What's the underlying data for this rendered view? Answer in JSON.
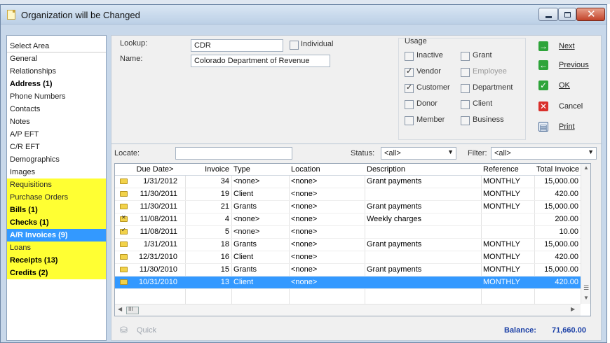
{
  "window": {
    "title": "Organization will be Changed"
  },
  "sidebar": {
    "header": "Select Area",
    "items": [
      {
        "label": "General",
        "style": "normal"
      },
      {
        "label": "Relationships",
        "style": "normal"
      },
      {
        "label": "Address (1)",
        "style": "bold"
      },
      {
        "label": "Phone Numbers",
        "style": "normal"
      },
      {
        "label": "Contacts",
        "style": "normal"
      },
      {
        "label": "Notes",
        "style": "normal"
      },
      {
        "label": "A/P EFT",
        "style": "normal"
      },
      {
        "label": "C/R EFT",
        "style": "normal"
      },
      {
        "label": "Demographics",
        "style": "normal"
      },
      {
        "label": "Images",
        "style": "normal"
      },
      {
        "label": "Requisitions",
        "style": "hl"
      },
      {
        "label": "Purchase Orders",
        "style": "hl"
      },
      {
        "label": "Bills (1)",
        "style": "hl-bold"
      },
      {
        "label": "Checks (1)",
        "style": "hl-bold"
      },
      {
        "label": "A/R Invoices (9)",
        "style": "selected"
      },
      {
        "label": "Loans",
        "style": "hl"
      },
      {
        "label": "Receipts (13)",
        "style": "hl-bold"
      },
      {
        "label": "Credits (2)",
        "style": "hl-bold"
      }
    ]
  },
  "form": {
    "lookup_label": "Lookup:",
    "lookup_value": "CDR",
    "individual_label": "Individual",
    "name_label": "Name:",
    "name_value": "Colorado Department of Revenue"
  },
  "usage": {
    "title": "Usage",
    "options": [
      {
        "label": "Inactive",
        "checked": false,
        "enabled": true
      },
      {
        "label": "Grant",
        "checked": false,
        "enabled": true
      },
      {
        "label": "Vendor",
        "checked": true,
        "enabled": true
      },
      {
        "label": "Employee",
        "checked": false,
        "enabled": false
      },
      {
        "label": "Customer",
        "checked": true,
        "enabled": true
      },
      {
        "label": "Department",
        "checked": false,
        "enabled": true
      },
      {
        "label": "Donor",
        "checked": false,
        "enabled": true
      },
      {
        "label": "Client",
        "checked": false,
        "enabled": true
      },
      {
        "label": "Member",
        "checked": false,
        "enabled": true
      },
      {
        "label": "Business",
        "checked": false,
        "enabled": true
      }
    ]
  },
  "actions": {
    "next": "Next",
    "previous": "Previous",
    "ok": "OK",
    "cancel": "Cancel",
    "print": "Print"
  },
  "filters": {
    "locate_label": "Locate:",
    "locate_value": "",
    "status_label": "Status:",
    "status_value": "<all>",
    "filter_label": "Filter:",
    "filter_value": "<all>"
  },
  "grid": {
    "columns": [
      "Due Date>",
      "Invoice",
      "Type",
      "Location",
      "Description",
      "Reference",
      "Total Invoice"
    ],
    "rows": [
      {
        "icon": "folder",
        "due": "1/31/2012",
        "invoice": "34",
        "type": "<none>",
        "location": "<none>",
        "description": "Grant payments",
        "reference": "MONTHLY",
        "total": "15,000.00"
      },
      {
        "icon": "folder",
        "due": "11/30/2011",
        "invoice": "19",
        "type": "Client",
        "location": "<none>",
        "description": "",
        "reference": "MONTHLY",
        "total": "420.00"
      },
      {
        "icon": "folder",
        "due": "11/30/2011",
        "invoice": "21",
        "type": "Grants",
        "location": "<none>",
        "description": "Grant payments",
        "reference": "MONTHLY",
        "total": "15,000.00"
      },
      {
        "icon": "folder-x",
        "due": "11/08/2011",
        "invoice": "4",
        "type": "<none>",
        "location": "<none>",
        "description": "Weekly charges",
        "reference": "",
        "total": "200.00"
      },
      {
        "icon": "folder-check",
        "due": "11/08/2011",
        "invoice": "5",
        "type": "<none>",
        "location": "<none>",
        "description": "",
        "reference": "",
        "total": "10.00"
      },
      {
        "icon": "folder",
        "due": "1/31/2011",
        "invoice": "18",
        "type": "Grants",
        "location": "<none>",
        "description": "Grant payments",
        "reference": "MONTHLY",
        "total": "15,000.00"
      },
      {
        "icon": "folder",
        "due": "12/31/2010",
        "invoice": "16",
        "type": "Client",
        "location": "<none>",
        "description": "",
        "reference": "MONTHLY",
        "total": "420.00"
      },
      {
        "icon": "folder",
        "due": "11/30/2010",
        "invoice": "15",
        "type": "Grants",
        "location": "<none>",
        "description": "Grant payments",
        "reference": "MONTHLY",
        "total": "15,000.00"
      },
      {
        "icon": "folder",
        "due": "10/31/2010",
        "invoice": "13",
        "type": "Client",
        "location": "<none>",
        "description": "",
        "reference": "MONTHLY",
        "total": "420.00",
        "selected": true
      }
    ],
    "hscroll_glyph": "III"
  },
  "footer": {
    "quick_label": "Quick",
    "balance_label": "Balance:",
    "balance_value": "71,660.00"
  },
  "colors": {
    "highlight": "#ffff33",
    "selected": "#3399ff",
    "balance": "#1a3fa6"
  }
}
